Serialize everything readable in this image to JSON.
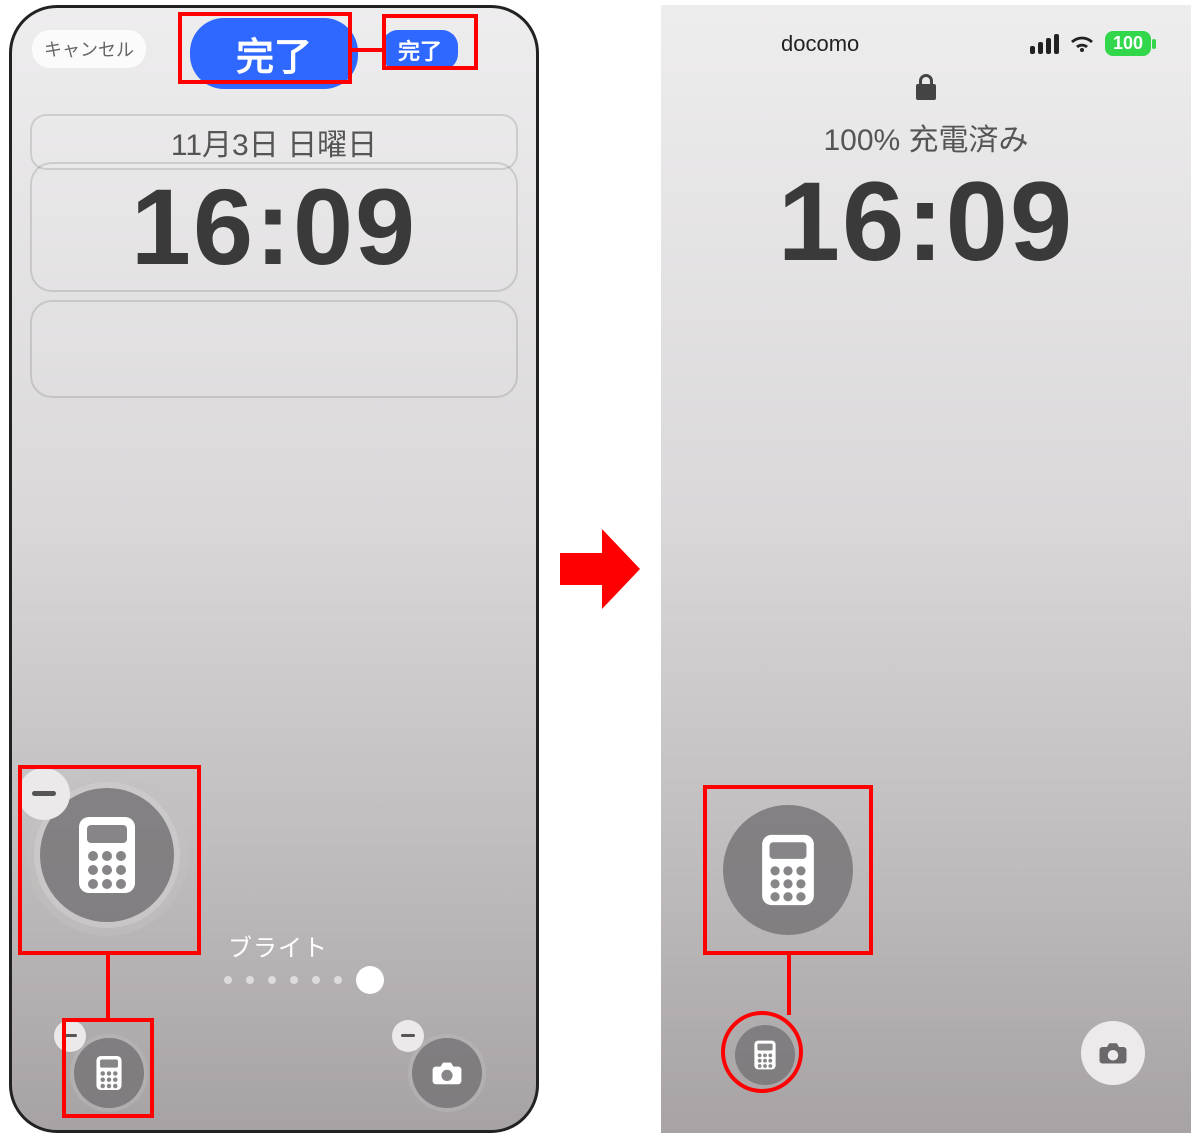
{
  "left": {
    "cancel_label": "キャンセル",
    "done_large": "完了",
    "done_small": "完了",
    "date": "11月3日 日曜日",
    "time": "16:09",
    "mode_label": "ブライト",
    "icons": {
      "calculator": "calculator-icon",
      "camera": "camera-icon",
      "remove": "minus-icon"
    }
  },
  "right": {
    "carrier": "docomo",
    "battery_pct": "100",
    "charge_text": "100% 充電済み",
    "time": "16:09",
    "icons": {
      "lock": "lock-icon",
      "signal": "cellular-signal-icon",
      "wifi": "wifi-icon",
      "battery": "battery-icon",
      "calculator": "calculator-icon",
      "camera": "camera-icon"
    }
  },
  "annotation": {
    "highlight_color": "#ff0000",
    "arrow_color": "#ff0000"
  }
}
